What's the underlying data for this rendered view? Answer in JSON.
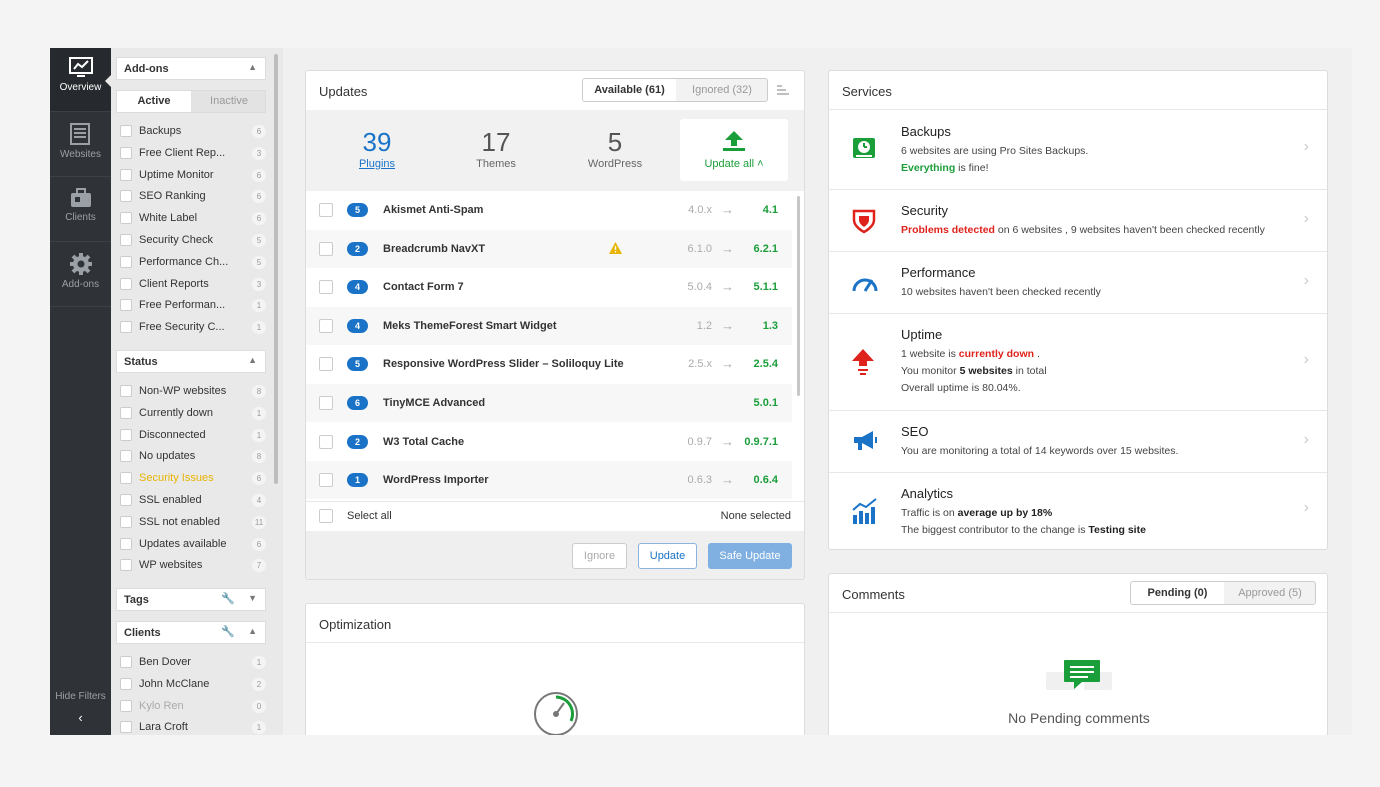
{
  "nav": {
    "items": [
      {
        "label": "Overview",
        "icon": "monitor-chart-icon"
      },
      {
        "label": "Websites",
        "icon": "websites-list-icon"
      },
      {
        "label": "Clients",
        "icon": "clients-briefcase-icon"
      },
      {
        "label": "Add-ons",
        "icon": "gear-icon"
      }
    ],
    "hide_filters": "Hide Filters",
    "collapse": "‹"
  },
  "filters": {
    "addons_title": "Add-ons",
    "tab_active": "Active",
    "tab_inactive": "Inactive",
    "addons": [
      {
        "label": "Backups",
        "count": "6"
      },
      {
        "label": "Free Client Rep...",
        "count": "3"
      },
      {
        "label": "Uptime Monitor",
        "count": "6"
      },
      {
        "label": "SEO Ranking",
        "count": "6"
      },
      {
        "label": "White Label",
        "count": "6"
      },
      {
        "label": "Security Check",
        "count": "5"
      },
      {
        "label": "Performance Ch...",
        "count": "5"
      },
      {
        "label": "Client Reports",
        "count": "3"
      },
      {
        "label": "Free Performan...",
        "count": "1"
      },
      {
        "label": "Free Security C...",
        "count": "1"
      }
    ],
    "status_title": "Status",
    "status": [
      {
        "label": "Non-WP websites",
        "count": "8"
      },
      {
        "label": "Currently down",
        "count": "1"
      },
      {
        "label": "Disconnected",
        "count": "1"
      },
      {
        "label": "No updates",
        "count": "8"
      },
      {
        "label": "Security Issues",
        "count": "6"
      },
      {
        "label": "SSL enabled",
        "count": "4"
      },
      {
        "label": "SSL not enabled",
        "count": "11"
      },
      {
        "label": "Updates available",
        "count": "6"
      },
      {
        "label": "WP websites",
        "count": "7"
      }
    ],
    "tags_title": "Tags",
    "clients_title": "Clients",
    "clients": [
      {
        "label": "Ben Dover",
        "count": "1"
      },
      {
        "label": "John McClane",
        "count": "2"
      },
      {
        "label": "Kylo Ren",
        "count": "0"
      },
      {
        "label": "Lara Croft",
        "count": "1"
      }
    ]
  },
  "updates": {
    "title": "Updates",
    "tab_available": "Available (61)",
    "tab_ignored": "Ignored (32)",
    "stats": [
      {
        "num": "39",
        "caption": "Plugins"
      },
      {
        "num": "17",
        "caption": "Themes"
      },
      {
        "num": "5",
        "caption": "WordPress"
      }
    ],
    "update_all": "Update all ˄",
    "rows": [
      {
        "badge": "5",
        "name": "Akismet Anti-Spam",
        "from": "4.0.x",
        "to": "4.1"
      },
      {
        "badge": "2",
        "name": "Breadcrumb NavXT",
        "from": "6.1.0",
        "to": "6.2.1"
      },
      {
        "badge": "4",
        "name": "Contact Form 7",
        "from": "5.0.4",
        "to": "5.1.1"
      },
      {
        "badge": "4",
        "name": "Meks ThemeForest Smart Widget",
        "from": "1.2",
        "to": "1.3"
      },
      {
        "badge": "5",
        "name": "Responsive WordPress Slider – Soliloquy Lite",
        "from": "2.5.x",
        "to": "2.5.4"
      },
      {
        "badge": "6",
        "name": "TinyMCE Advanced",
        "from": "",
        "to": "5.0.1"
      },
      {
        "badge": "2",
        "name": "W3 Total Cache",
        "from": "0.9.7",
        "to": "0.9.7.1"
      },
      {
        "badge": "1",
        "name": "WordPress Importer",
        "from": "0.6.3",
        "to": "0.6.4"
      }
    ],
    "select_all": "Select all",
    "none_selected": "None selected",
    "btn_ignore": "Ignore",
    "btn_update": "Update",
    "btn_safe_update": "Safe Update"
  },
  "optimization": {
    "title": "Optimization"
  },
  "services": {
    "title": "Services",
    "backups": {
      "title": "Backups",
      "line1": "6 websites are using Pro Sites Backups.",
      "line2_b": "Everything",
      "line2": " is fine!"
    },
    "security": {
      "title": "Security",
      "line1_b": "Problems detected",
      "line1": " on 6 websites , 9 websites haven't been checked recently"
    },
    "performance": {
      "title": "Performance",
      "line1": "10 websites haven't been checked recently"
    },
    "uptime": {
      "title": "Uptime",
      "l1a": "1 website is ",
      "l1b": "currently down",
      "l1c": " .",
      "l2a": "You monitor ",
      "l2b": "5 websites",
      "l2c": " in total",
      "l3": "Overall uptime is 80.04%."
    },
    "seo": {
      "title": "SEO",
      "line1": "You are monitoring a total of 14 keywords over 15 websites."
    },
    "analytics": {
      "title": "Analytics",
      "l1a": "Traffic is on ",
      "l1b": "average up by 18%",
      "l2a": "The biggest contributor to the change is ",
      "l2b": "Testing site"
    }
  },
  "comments": {
    "title": "Comments",
    "tab_pending": "Pending (0)",
    "tab_approved": "Approved (5)",
    "empty": "No Pending comments"
  },
  "colors": {
    "accent": "#1a73c7",
    "success": "#1a9e3a",
    "danger": "#e0221c",
    "warning": "#e8b400"
  }
}
